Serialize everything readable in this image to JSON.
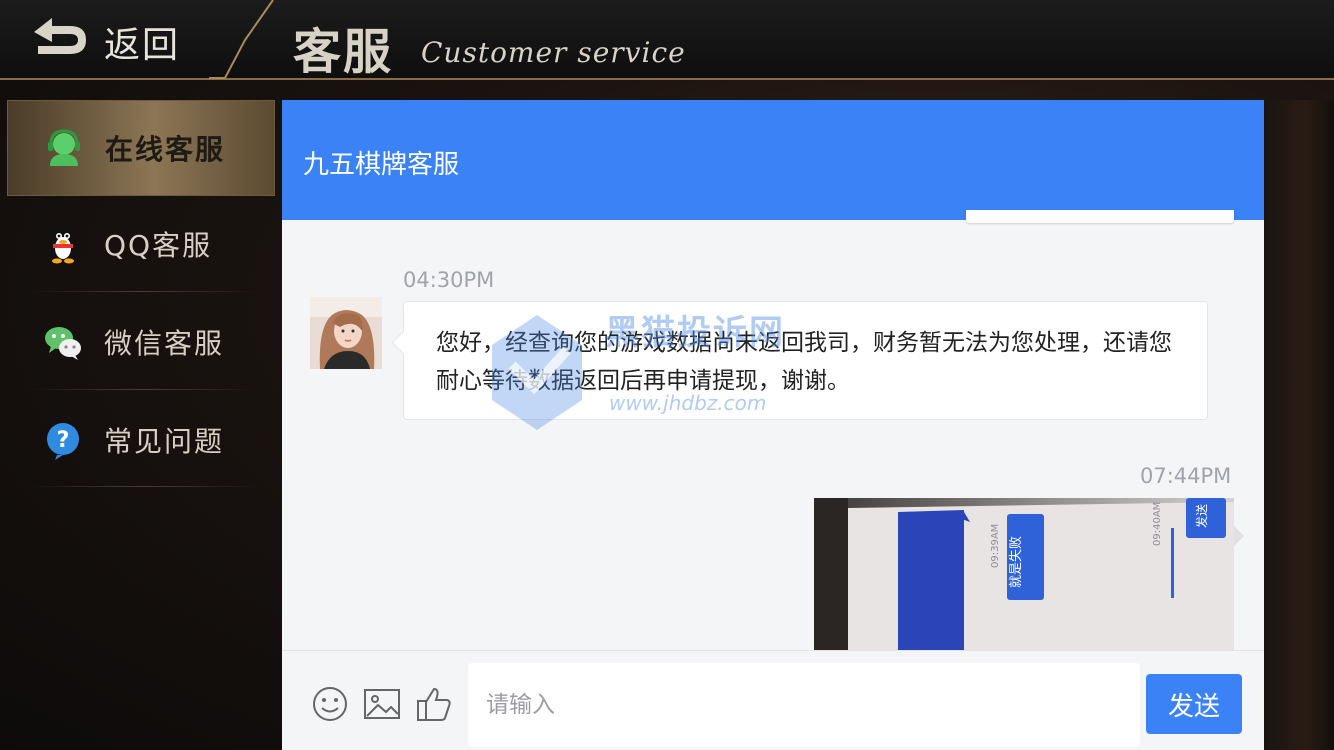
{
  "topbar": {
    "back_label": "返回",
    "title": "客服",
    "subtitle": "Customer service"
  },
  "sidebar": {
    "items": [
      {
        "label": "在线客服",
        "icon": "headset-icon",
        "active": true
      },
      {
        "label": "QQ客服",
        "icon": "qq-penguin-icon",
        "active": false
      },
      {
        "label": "微信客服",
        "icon": "wechat-icon",
        "active": false
      },
      {
        "label": "常见问题",
        "icon": "question-icon",
        "active": false
      }
    ]
  },
  "chat": {
    "title": "九五棋牌客服",
    "messages": [
      {
        "time": "04:30PM",
        "from": "agent",
        "text": "您好，经查询您的游戏数据尚未返回我司，财务暂无法为您处理，还请您耐心等待数据返回后再申请提现，谢谢。"
      },
      {
        "time": "07:44PM",
        "from": "user",
        "photo_texts": [
          "就是失败",
          "09:39AM",
          "09:40AM",
          "发送"
        ]
      }
    ]
  },
  "watermark": {
    "text": "黑猫投诉网",
    "url": "www.jhdbz.com"
  },
  "input": {
    "placeholder": "请输入",
    "value": "",
    "send_label": "发送"
  },
  "colors": {
    "accent_blue": "#3a82f6",
    "gold_border": "#8a6d44"
  }
}
